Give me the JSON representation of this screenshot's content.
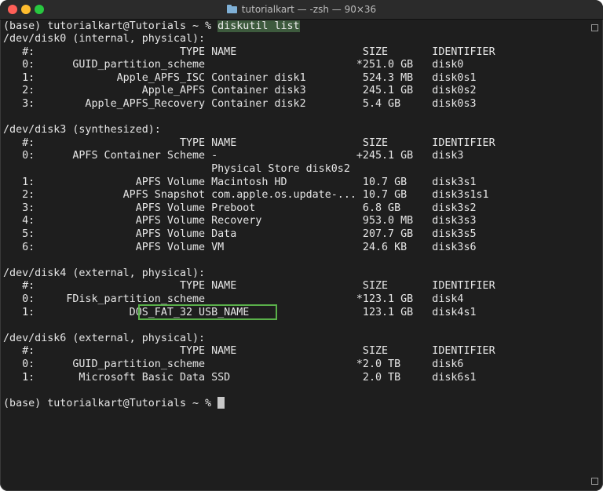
{
  "window": {
    "title": "tutorialkart — -zsh — 90×36"
  },
  "prompt": {
    "text": "(base) tutorialkart@Tutorials ~ % ",
    "command": "diskutil list"
  },
  "final_prompt": "(base) tutorialkart@Tutorials ~ % ",
  "output": [
    "/dev/disk0 (internal, physical):",
    "   #:                       TYPE NAME                    SIZE       IDENTIFIER",
    "   0:      GUID_partition_scheme                        *251.0 GB   disk0",
    "   1:             Apple_APFS_ISC Container disk1         524.3 MB   disk0s1",
    "   2:                 Apple_APFS Container disk3         245.1 GB   disk0s2",
    "   3:        Apple_APFS_Recovery Container disk2         5.4 GB     disk0s3",
    "",
    "/dev/disk3 (synthesized):",
    "   #:                       TYPE NAME                    SIZE       IDENTIFIER",
    "   0:      APFS Container Scheme -                      +245.1 GB   disk3",
    "                                 Physical Store disk0s2",
    "   1:                APFS Volume Macintosh HD            10.7 GB    disk3s1",
    "   2:              APFS Snapshot com.apple.os.update-... 10.7 GB    disk3s1s1",
    "   3:                APFS Volume Preboot                 6.8 GB     disk3s2",
    "   4:                APFS Volume Recovery                953.0 MB   disk3s3",
    "   5:                APFS Volume Data                    207.7 GB   disk3s5",
    "   6:                APFS Volume VM                      24.6 KB    disk3s6",
    "",
    "/dev/disk4 (external, physical):",
    "   #:                       TYPE NAME                    SIZE       IDENTIFIER",
    "   0:     FDisk_partition_scheme                        *123.1 GB   disk4",
    "   1:               DOS_FAT_32 USB_NAME                  123.1 GB   disk4s1",
    "",
    "/dev/disk6 (external, physical):",
    "   #:                       TYPE NAME                    SIZE       IDENTIFIER",
    "   0:      GUID_partition_scheme                        *2.0 TB     disk6",
    "   1:       Microsoft Basic Data SSD                     2.0 TB     disk6s1"
  ],
  "highlight": {
    "color": "#5ab04a"
  }
}
